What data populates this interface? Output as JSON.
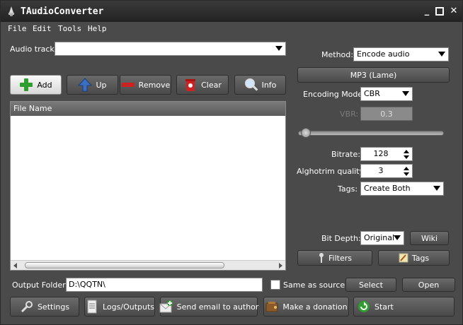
{
  "window": {
    "title": "TAudioConverter"
  },
  "menu": [
    "File",
    "Edit",
    "Tools",
    "Help"
  ],
  "audio_track": {
    "label": "Audio track:",
    "value": ""
  },
  "toolbar": {
    "add": "Add",
    "up": "Up",
    "remove": "Remove",
    "clear": "Clear",
    "info": "Info"
  },
  "file_list": {
    "column": "File Name",
    "items": []
  },
  "encoder": {
    "method_label": "Method:",
    "method_value": "Encode audio",
    "codec_button": "MP3 (Lame)",
    "mode_label": "Encoding Mode:",
    "mode_value": "CBR",
    "vbr_label": "VBR:",
    "vbr_value": "0.3",
    "vbr_slider_level": 0.05,
    "bitrate_label": "Bitrate:",
    "bitrate_value": "128",
    "quality_label": "Alghotrim quality:",
    "quality_value": "3",
    "tags_label": "Tags:",
    "tags_value": "Create Both",
    "bitdepth_label": "Bit Depth:",
    "bitdepth_value": "Original",
    "wiki_button": "Wiki",
    "filters_button": "Filters",
    "tags_button": "Tags"
  },
  "output": {
    "label": "Output Folder:",
    "value": "D:\\QQTN\\",
    "same_as_source": "Same as source",
    "same_as_source_checked": false,
    "select_button": "Select",
    "open_button": "Open"
  },
  "bottom": {
    "settings": "Settings",
    "logs": "Logs/Outputs",
    "email": "Send email to author",
    "donation": "Make a donation",
    "start": "Start"
  },
  "colors": {
    "window_bg": "#4a4a4a",
    "titlebar": "#222222",
    "add_green": "#2e9e2e",
    "remove_red": "#cc2222",
    "up_blue": "#3a6fc4",
    "start_green": "#2e9e2e"
  }
}
